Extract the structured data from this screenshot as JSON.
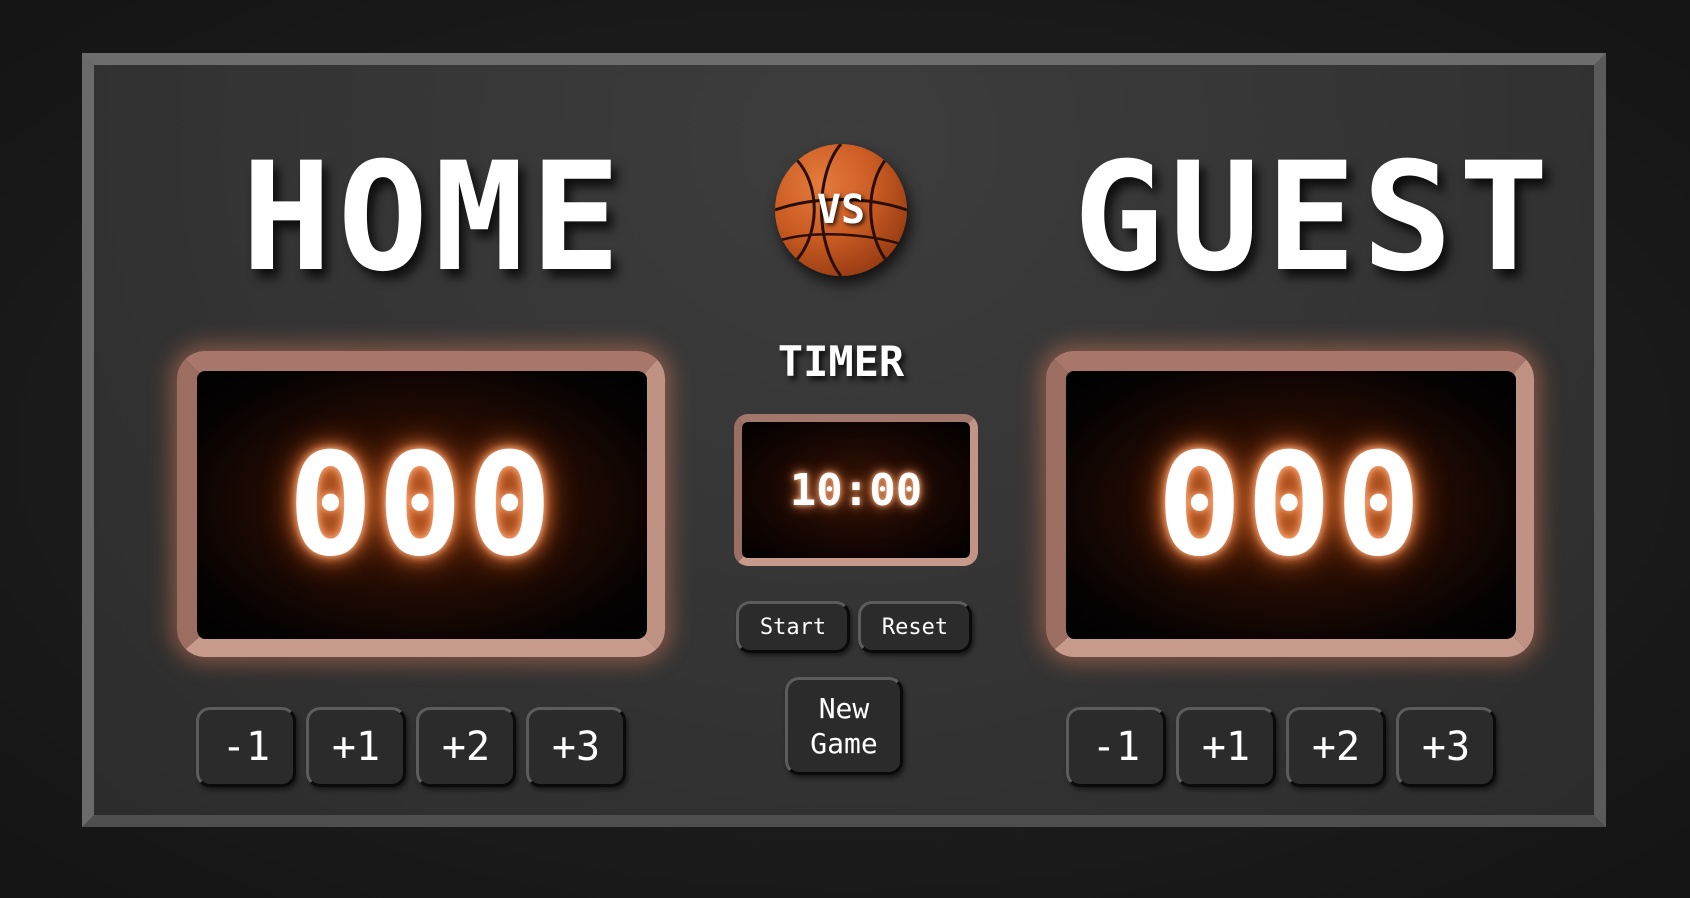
{
  "home": {
    "name": "HOME",
    "score": "000",
    "buttons": [
      "-1",
      "+1",
      "+2",
      "+3"
    ]
  },
  "guest": {
    "name": "GUEST",
    "score": "000",
    "buttons": [
      "-1",
      "+1",
      "+2",
      "+3"
    ]
  },
  "center": {
    "vs_label": "VS",
    "timer_label": "TIMER",
    "timer_value": "10:00",
    "start_label": "Start",
    "reset_label": "Reset",
    "new_game_label": "New\nGame"
  },
  "colors": {
    "background": "#1b1b1b",
    "board": "#363636",
    "frame_copper": "#c09284",
    "glow": "#ff8a4a",
    "text": "#ffffff"
  },
  "icons": {
    "ball": "basketball-icon"
  }
}
